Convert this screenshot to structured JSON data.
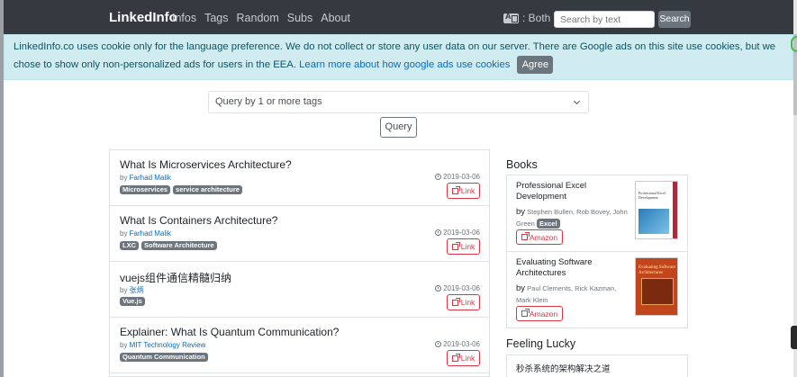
{
  "navbar": {
    "brand": "LinkedInfo",
    "links": [
      "Infos",
      "Tags",
      "Random",
      "Subs",
      "About"
    ],
    "lang_label": ": Both",
    "search_placeholder": "Search by text",
    "search_button": "Search"
  },
  "cookie": {
    "text": "LinkedInfo.co uses cookie only for the language preference. We do not collect or store any user data on our server. There are Google ads on this site use cookies, but we chose to show only non-personalized ads for users in the EEA. ",
    "link": "Learn more about how google ads use cookies",
    "agree": "Agree"
  },
  "query": {
    "placeholder": "Query by 1 or more tags",
    "button": "Query"
  },
  "items": [
    {
      "title": "What Is Microservices Architecture?",
      "by": "by ",
      "author": "Farhad Malik",
      "tags": [
        "Microservices",
        "service architecture"
      ],
      "date": "2019-03-06",
      "link": "Link"
    },
    {
      "title": "What Is Containers Architecture?",
      "by": "by ",
      "author": "Farhad Malik",
      "tags": [
        "LXC",
        "Software Architecture"
      ],
      "date": "2019-03-06",
      "link": "Link"
    },
    {
      "title": "vuejs组件通信精髓归纳",
      "by": "by ",
      "author": "张炳",
      "tags": [
        "Vue.js"
      ],
      "date": "2019-03-06",
      "link": "Link"
    },
    {
      "title": "Explainer: What Is Quantum Communication?",
      "by": "by ",
      "author": "MIT Technology Review",
      "tags": [
        "Quantum Communication"
      ],
      "date": "2019-03-06",
      "link": "Link"
    }
  ],
  "sidebar": {
    "books_heading": "Books",
    "books": [
      {
        "title": "Professional Excel Development",
        "by": "by",
        "authors": "Stephen Bullen, Rob Bovey, John Green",
        "tag": "Excel",
        "button": "Amazon"
      },
      {
        "title": "Evaluating Software Architectures",
        "by": "by",
        "authors": "Paul Clements, Rick Kazman, Mark Klein",
        "tag": "",
        "button": "Amazon"
      }
    ],
    "lucky_heading": "Feeling Lucky",
    "lucky_item": "秒杀系统的架构解决之道"
  },
  "covers": {
    "book1_title": "Professional Excel Development",
    "book2_title": "Evaluating Software Architectures"
  }
}
